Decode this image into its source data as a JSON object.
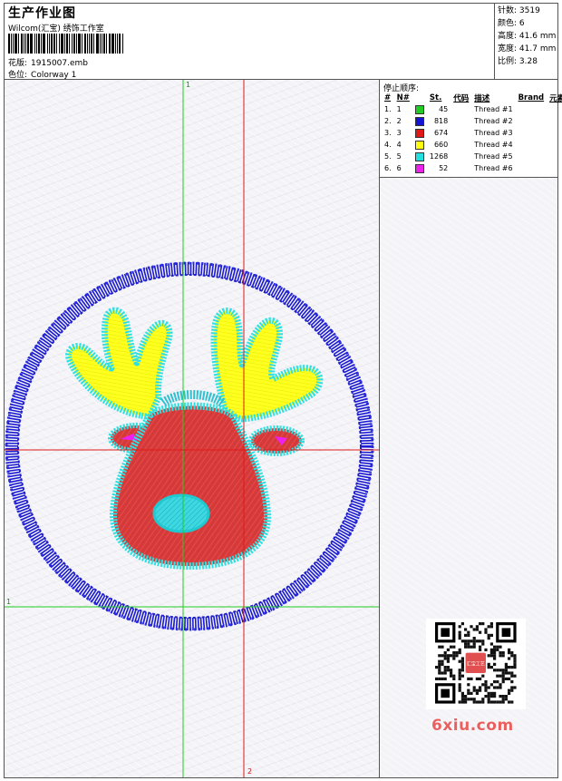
{
  "header": {
    "title": "生产作业图",
    "company": "Wilcom(汇宝) 绣饰工作室",
    "design_label": "花版:",
    "design_file": "1915007.emb",
    "colorway_label": "色位:",
    "colorway_value": "Colorway 1"
  },
  "stats": {
    "stitches_label": "针数:",
    "stitches": "3519",
    "colors_label": "颜色:",
    "colors": "6",
    "height_label": "高度:",
    "height": "41.6 mm",
    "width_label": "宽度:",
    "width": "41.7 mm",
    "ratio_label": "比例:",
    "ratio": "3.28"
  },
  "stop_sequence": {
    "title": "停止顺序:",
    "headers": [
      "#",
      "N#",
      "St.",
      "代码",
      "描述",
      "Brand",
      "元素"
    ],
    "rows": [
      {
        "idx": "1.",
        "n": "1",
        "color": "#22cc22",
        "stitches": "45",
        "code": "",
        "desc": "Thread #1"
      },
      {
        "idx": "2.",
        "n": "2",
        "color": "#1414d2",
        "stitches": "818",
        "code": "",
        "desc": "Thread #2"
      },
      {
        "idx": "3.",
        "n": "3",
        "color": "#e01818",
        "stitches": "674",
        "code": "",
        "desc": "Thread #3"
      },
      {
        "idx": "4.",
        "n": "4",
        "color": "#ffff10",
        "stitches": "660",
        "code": "",
        "desc": "Thread #4"
      },
      {
        "idx": "5.",
        "n": "5",
        "color": "#20e0e0",
        "stitches": "1268",
        "code": "",
        "desc": "Thread #5"
      },
      {
        "idx": "6.",
        "n": "6",
        "color": "#ee20ee",
        "stitches": "52",
        "code": "",
        "desc": "Thread #6"
      }
    ]
  },
  "guides": {
    "top_marker": "1",
    "left_marker": "1",
    "bottom_marker": "2"
  },
  "watermark": {
    "text": "6xiu.com",
    "seal_text": "汇宝工艺"
  }
}
